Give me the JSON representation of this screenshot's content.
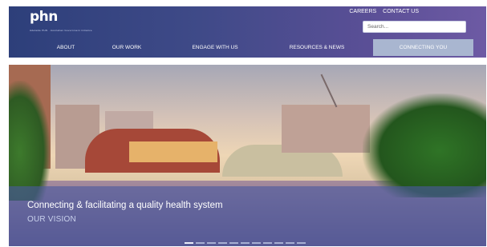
{
  "brand": {
    "logo_text": "phn",
    "logo_tagline": "Adelaide PHN · Australian Government initiative"
  },
  "utility_links": [
    "CAREERS",
    "CONTACT US"
  ],
  "search": {
    "placeholder": "Search..."
  },
  "nav": {
    "items": [
      {
        "label": "ABOUT"
      },
      {
        "label": "OUR WORK"
      },
      {
        "label": "ENGAGE WITH US"
      },
      {
        "label": "RESOURCES & NEWS"
      },
      {
        "label": "CONNECTING YOU",
        "active": true
      }
    ]
  },
  "hero": {
    "tagline": "Connecting & facilitating a quality health system",
    "link_label": "OUR VISION",
    "slide_count": 11,
    "active_slide": 0
  },
  "colors": {
    "header_start": "#2d3f7a",
    "header_end": "#6d5aa4",
    "active_nav": "#a9b6d0",
    "overlay": "#4a58a0"
  }
}
